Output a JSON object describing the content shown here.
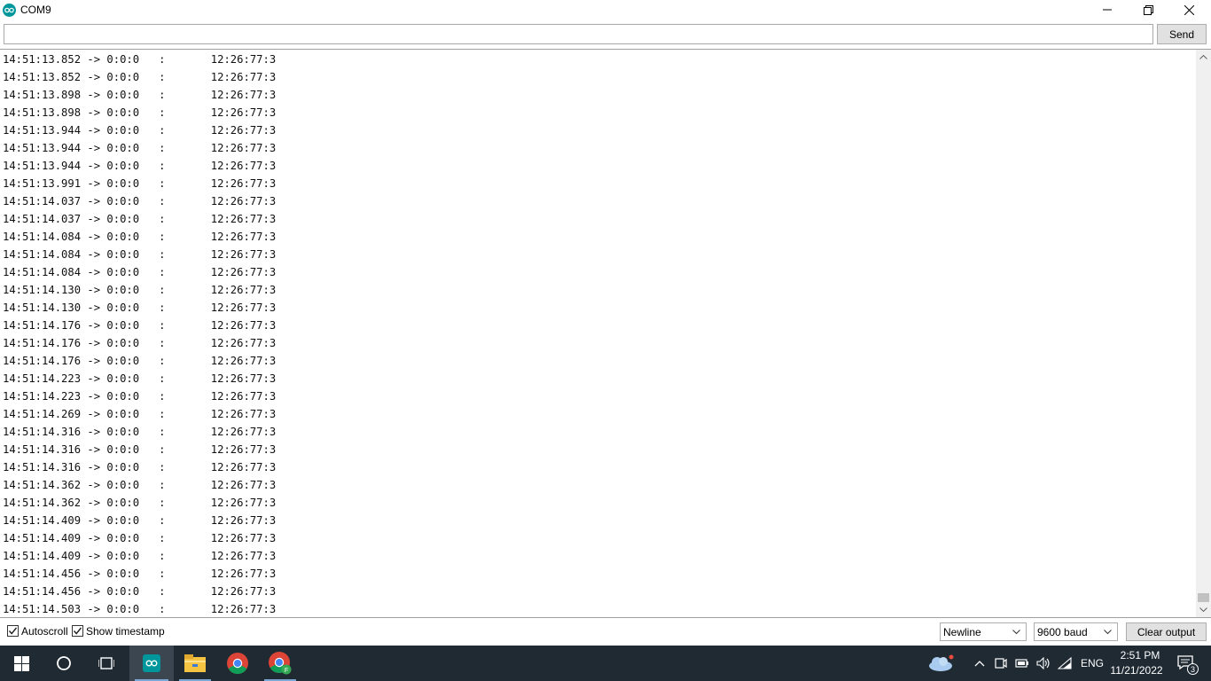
{
  "window": {
    "title": "COM9"
  },
  "send": {
    "input_value": "",
    "button_label": "Send"
  },
  "output_lines": [
    "14:51:13.852 -> 0:0:0   :       12:26:77:3",
    "14:51:13.852 -> 0:0:0   :       12:26:77:3",
    "14:51:13.898 -> 0:0:0   :       12:26:77:3",
    "14:51:13.898 -> 0:0:0   :       12:26:77:3",
    "14:51:13.944 -> 0:0:0   :       12:26:77:3",
    "14:51:13.944 -> 0:0:0   :       12:26:77:3",
    "14:51:13.944 -> 0:0:0   :       12:26:77:3",
    "14:51:13.991 -> 0:0:0   :       12:26:77:3",
    "14:51:14.037 -> 0:0:0   :       12:26:77:3",
    "14:51:14.037 -> 0:0:0   :       12:26:77:3",
    "14:51:14.084 -> 0:0:0   :       12:26:77:3",
    "14:51:14.084 -> 0:0:0   :       12:26:77:3",
    "14:51:14.084 -> 0:0:0   :       12:26:77:3",
    "14:51:14.130 -> 0:0:0   :       12:26:77:3",
    "14:51:14.130 -> 0:0:0   :       12:26:77:3",
    "14:51:14.176 -> 0:0:0   :       12:26:77:3",
    "14:51:14.176 -> 0:0:0   :       12:26:77:3",
    "14:51:14.176 -> 0:0:0   :       12:26:77:3",
    "14:51:14.223 -> 0:0:0   :       12:26:77:3",
    "14:51:14.223 -> 0:0:0   :       12:26:77:3",
    "14:51:14.269 -> 0:0:0   :       12:26:77:3",
    "14:51:14.316 -> 0:0:0   :       12:26:77:3",
    "14:51:14.316 -> 0:0:0   :       12:26:77:3",
    "14:51:14.316 -> 0:0:0   :       12:26:77:3",
    "14:51:14.362 -> 0:0:0   :       12:26:77:3",
    "14:51:14.362 -> 0:0:0   :       12:26:77:3",
    "14:51:14.409 -> 0:0:0   :       12:26:77:3",
    "14:51:14.409 -> 0:0:0   :       12:26:77:3",
    "14:51:14.409 -> 0:0:0   :       12:26:77:3",
    "14:51:14.456 -> 0:0:0   :       12:26:77:3",
    "14:51:14.456 -> 0:0:0   :       12:26:77:3",
    "14:51:14.503 -> 0:0:0   :       12:26:77:3"
  ],
  "bottom": {
    "autoscroll_label": "Autoscroll",
    "autoscroll_checked": true,
    "timestamp_label": "Show timestamp",
    "timestamp_checked": true,
    "line_ending": "Newline",
    "baud_rate": "9600 baud",
    "clear_label": "Clear output"
  },
  "taskbar": {
    "apps": [
      "windows-start-icon",
      "cortana-search-icon",
      "task-view-icon",
      "arduino-icon",
      "file-explorer-icon",
      "chrome-icon",
      "chrome-profile-icon"
    ],
    "language": "ENG",
    "time": "2:51 PM",
    "date": "11/21/2022",
    "notification_count": "3"
  },
  "colors": {
    "arduino_teal": "#00979c",
    "taskbar_bg": "#1f2a33"
  }
}
